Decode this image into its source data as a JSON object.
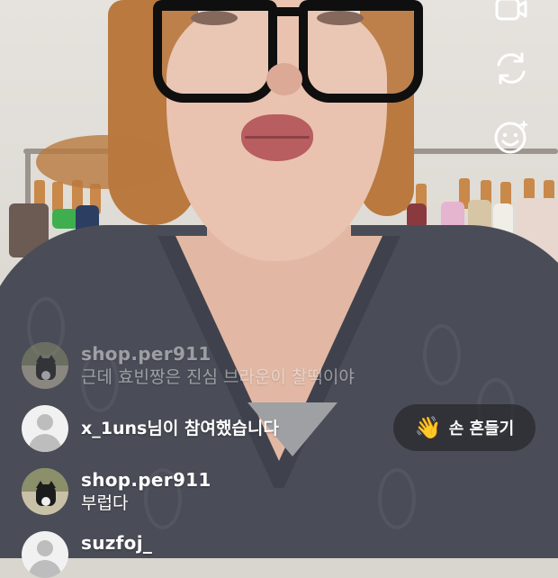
{
  "controls": [
    {
      "name": "video-camera-icon"
    },
    {
      "name": "switch-camera-icon"
    },
    {
      "name": "face-effects-icon"
    }
  ],
  "comments": [
    {
      "username": "shop.per911",
      "text": "근데 효빈짱은 진심 브라운이 찰떡이야",
      "avatar": "cat-photo",
      "faded": true
    },
    {
      "username": "shop.per911",
      "text": "부럽다",
      "avatar": "cat-photo"
    },
    {
      "username": "suzfoj_",
      "text": "",
      "avatar": "default"
    }
  ],
  "join_notice": {
    "username": "x_1uns",
    "text": "x_1uns님이 참여했습니다",
    "avatar": "default"
  },
  "wave_button": {
    "icon": "waving-hand-icon",
    "label": "손 흔들기"
  }
}
